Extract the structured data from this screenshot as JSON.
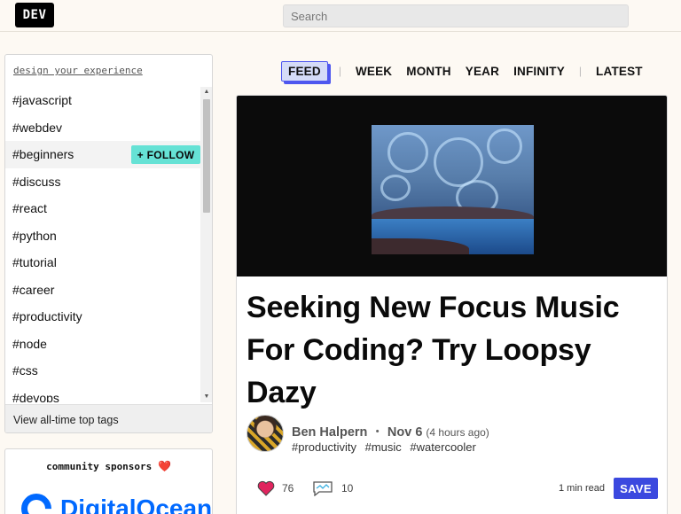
{
  "header": {
    "logo_text": "DEV",
    "search_placeholder": "Search"
  },
  "sidebar": {
    "design_link": "design your experience",
    "tags": [
      {
        "label": "#javascript"
      },
      {
        "label": "#webdev"
      },
      {
        "label": "#beginners",
        "hovered": true
      },
      {
        "label": "#discuss"
      },
      {
        "label": "#react"
      },
      {
        "label": "#python"
      },
      {
        "label": "#tutorial"
      },
      {
        "label": "#career"
      },
      {
        "label": "#productivity"
      },
      {
        "label": "#node"
      },
      {
        "label": "#css"
      },
      {
        "label": "#devops"
      }
    ],
    "follow_label": "+ FOLLOW",
    "view_all_label": "View all-time top tags",
    "follow_color": "#66e2d5"
  },
  "sponsors": {
    "title": "community sponsors",
    "heart": "❤️",
    "sponsor_name": "DigitalOcean",
    "sponsor_color": "#0069ff"
  },
  "feed": {
    "tabs": [
      {
        "label": "FEED",
        "active": true
      },
      {
        "label": "WEEK"
      },
      {
        "label": "MONTH"
      },
      {
        "label": "YEAR"
      },
      {
        "label": "INFINITY"
      },
      {
        "label": "LATEST"
      }
    ],
    "accent_color": "#4e57ef"
  },
  "article": {
    "title": "Seeking New Focus Music For Coding? Try Loopsy Dazy",
    "author": "Ben Halpern",
    "date": "Nov 6",
    "relative_time": "(4 hours ago)",
    "tags": [
      "#productivity",
      "#music",
      "#watercooler"
    ],
    "reactions": "76",
    "comments": "10",
    "read_time": "1 min read",
    "save_label": "SAVE",
    "save_color": "#3b49df"
  }
}
